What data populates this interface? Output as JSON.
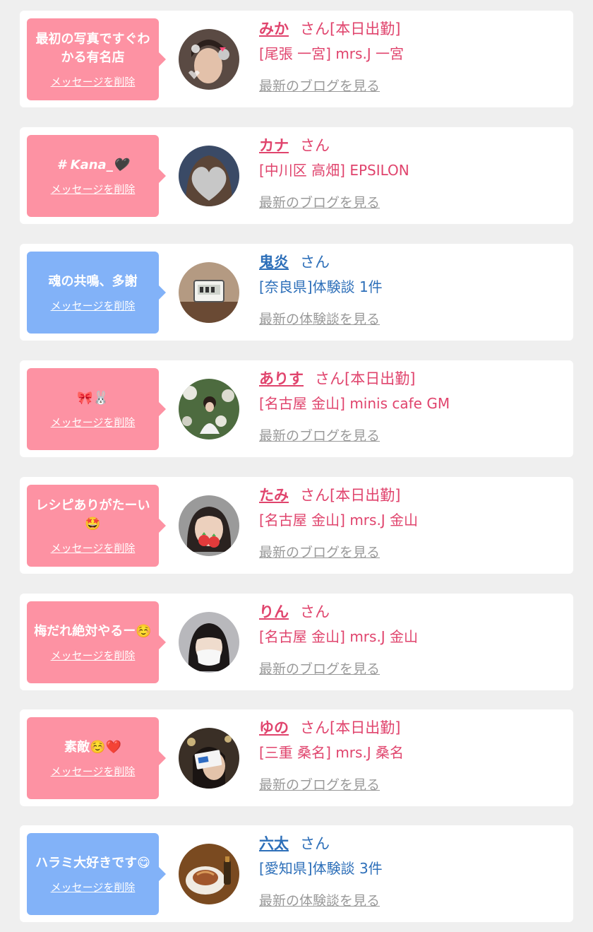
{
  "colors": {
    "pink_bubble": "#fd92a3",
    "blue_bubble": "#82b2f8",
    "pink_text": "#e0446d",
    "blue_text": "#2d6fb9",
    "link_gray": "#9a9a9a"
  },
  "entries": [
    {
      "message": "最初の写真ですぐわかる有名店",
      "delete": "メッセージを削除",
      "name": "みか",
      "honorific": "さん",
      "status": "[本日出勤]",
      "sub": "[尾張 一宮] mrs.J 一宮",
      "link": "最新のブログを見る",
      "type": "girl",
      "avatar": "selfie-photo"
    },
    {
      "message": "# Kana_🖤",
      "delete": "メッセージを削除",
      "name": "カナ",
      "honorific": "さん",
      "status": "",
      "sub": "[中川区 高畑] EPSILON",
      "link": "最新のブログを見る",
      "type": "girl",
      "avatar": "face-covered-by-heart-photo"
    },
    {
      "message": "魂の共鳴、多謝",
      "delete": "メッセージを削除",
      "name": "鬼炎",
      "honorific": "さん",
      "status": "",
      "sub": "[奈良県]体験談 1件",
      "link": "最新の体験談を見る",
      "type": "user",
      "avatar": "digital-clock-photo"
    },
    {
      "message": "🎀🐰",
      "delete": "メッセージを削除",
      "name": "ありす",
      "honorific": "さん",
      "status": "[本日出勤]",
      "sub": "[名古屋 金山] minis cafe GM",
      "link": "最新のブログを見る",
      "type": "girl",
      "avatar": "flower-garden-photo"
    },
    {
      "message": "レシピありがたーい🤩",
      "delete": "メッセージを削除",
      "name": "たみ",
      "honorific": "さん",
      "status": "[本日出勤]",
      "sub": "[名古屋 金山] mrs.J 金山",
      "link": "最新のブログを見る",
      "type": "girl",
      "avatar": "strawberry-selfie-photo"
    },
    {
      "message": "梅だれ絶対やるー☺️",
      "delete": "メッセージを削除",
      "name": "りん",
      "honorific": "さん",
      "status": "",
      "sub": "[名古屋 金山] mrs.J 金山",
      "link": "最新のブログを見る",
      "type": "girl",
      "avatar": "mask-selfie-photo"
    },
    {
      "message": "素敵☺️❤️",
      "delete": "メッセージを削除",
      "name": "ゆの",
      "honorific": "さん",
      "status": "[本日出勤]",
      "sub": "[三重 桑名] mrs.J 桑名",
      "link": "最新のブログを見る",
      "type": "girl",
      "avatar": "card-selfie-photo"
    },
    {
      "message": "ハラミ大好きです😋",
      "delete": "メッセージを削除",
      "name": "六太",
      "honorific": "さん",
      "status": "",
      "sub": "[愛知県]体験談 3件",
      "link": "最新の体験談を見る",
      "type": "user",
      "avatar": "food-plate-photo"
    }
  ]
}
